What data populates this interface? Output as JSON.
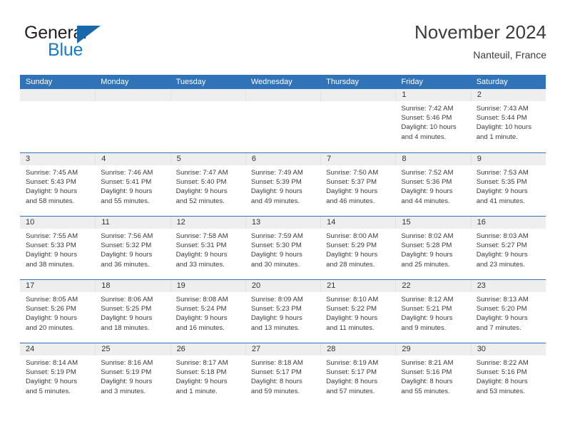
{
  "brand": {
    "name_top": "General",
    "name_bottom": "Blue",
    "accent_color": "#1769ac",
    "text_color": "#231f20"
  },
  "header": {
    "title": "November 2024",
    "subtitle": "Nanteuil, France"
  },
  "theme": {
    "header_bar_color": "#3173b9",
    "daynum_band_color": "#eeeeee",
    "week_separator_color": "#3173b9"
  },
  "weekdays": [
    "Sunday",
    "Monday",
    "Tuesday",
    "Wednesday",
    "Thursday",
    "Friday",
    "Saturday"
  ],
  "weeks": [
    [
      {
        "day": "",
        "empty": true
      },
      {
        "day": "",
        "empty": true
      },
      {
        "day": "",
        "empty": true
      },
      {
        "day": "",
        "empty": true
      },
      {
        "day": "",
        "empty": true
      },
      {
        "day": "1",
        "sunrise": "Sunrise: 7:42 AM",
        "sunset": "Sunset: 5:46 PM",
        "daylight1": "Daylight: 10 hours",
        "daylight2": "and 4 minutes."
      },
      {
        "day": "2",
        "sunrise": "Sunrise: 7:43 AM",
        "sunset": "Sunset: 5:44 PM",
        "daylight1": "Daylight: 10 hours",
        "daylight2": "and 1 minute."
      }
    ],
    [
      {
        "day": "3",
        "sunrise": "Sunrise: 7:45 AM",
        "sunset": "Sunset: 5:43 PM",
        "daylight1": "Daylight: 9 hours",
        "daylight2": "and 58 minutes."
      },
      {
        "day": "4",
        "sunrise": "Sunrise: 7:46 AM",
        "sunset": "Sunset: 5:41 PM",
        "daylight1": "Daylight: 9 hours",
        "daylight2": "and 55 minutes."
      },
      {
        "day": "5",
        "sunrise": "Sunrise: 7:47 AM",
        "sunset": "Sunset: 5:40 PM",
        "daylight1": "Daylight: 9 hours",
        "daylight2": "and 52 minutes."
      },
      {
        "day": "6",
        "sunrise": "Sunrise: 7:49 AM",
        "sunset": "Sunset: 5:39 PM",
        "daylight1": "Daylight: 9 hours",
        "daylight2": "and 49 minutes."
      },
      {
        "day": "7",
        "sunrise": "Sunrise: 7:50 AM",
        "sunset": "Sunset: 5:37 PM",
        "daylight1": "Daylight: 9 hours",
        "daylight2": "and 46 minutes."
      },
      {
        "day": "8",
        "sunrise": "Sunrise: 7:52 AM",
        "sunset": "Sunset: 5:36 PM",
        "daylight1": "Daylight: 9 hours",
        "daylight2": "and 44 minutes."
      },
      {
        "day": "9",
        "sunrise": "Sunrise: 7:53 AM",
        "sunset": "Sunset: 5:35 PM",
        "daylight1": "Daylight: 9 hours",
        "daylight2": "and 41 minutes."
      }
    ],
    [
      {
        "day": "10",
        "sunrise": "Sunrise: 7:55 AM",
        "sunset": "Sunset: 5:33 PM",
        "daylight1": "Daylight: 9 hours",
        "daylight2": "and 38 minutes."
      },
      {
        "day": "11",
        "sunrise": "Sunrise: 7:56 AM",
        "sunset": "Sunset: 5:32 PM",
        "daylight1": "Daylight: 9 hours",
        "daylight2": "and 36 minutes."
      },
      {
        "day": "12",
        "sunrise": "Sunrise: 7:58 AM",
        "sunset": "Sunset: 5:31 PM",
        "daylight1": "Daylight: 9 hours",
        "daylight2": "and 33 minutes."
      },
      {
        "day": "13",
        "sunrise": "Sunrise: 7:59 AM",
        "sunset": "Sunset: 5:30 PM",
        "daylight1": "Daylight: 9 hours",
        "daylight2": "and 30 minutes."
      },
      {
        "day": "14",
        "sunrise": "Sunrise: 8:00 AM",
        "sunset": "Sunset: 5:29 PM",
        "daylight1": "Daylight: 9 hours",
        "daylight2": "and 28 minutes."
      },
      {
        "day": "15",
        "sunrise": "Sunrise: 8:02 AM",
        "sunset": "Sunset: 5:28 PM",
        "daylight1": "Daylight: 9 hours",
        "daylight2": "and 25 minutes."
      },
      {
        "day": "16",
        "sunrise": "Sunrise: 8:03 AM",
        "sunset": "Sunset: 5:27 PM",
        "daylight1": "Daylight: 9 hours",
        "daylight2": "and 23 minutes."
      }
    ],
    [
      {
        "day": "17",
        "sunrise": "Sunrise: 8:05 AM",
        "sunset": "Sunset: 5:26 PM",
        "daylight1": "Daylight: 9 hours",
        "daylight2": "and 20 minutes."
      },
      {
        "day": "18",
        "sunrise": "Sunrise: 8:06 AM",
        "sunset": "Sunset: 5:25 PM",
        "daylight1": "Daylight: 9 hours",
        "daylight2": "and 18 minutes."
      },
      {
        "day": "19",
        "sunrise": "Sunrise: 8:08 AM",
        "sunset": "Sunset: 5:24 PM",
        "daylight1": "Daylight: 9 hours",
        "daylight2": "and 16 minutes."
      },
      {
        "day": "20",
        "sunrise": "Sunrise: 8:09 AM",
        "sunset": "Sunset: 5:23 PM",
        "daylight1": "Daylight: 9 hours",
        "daylight2": "and 13 minutes."
      },
      {
        "day": "21",
        "sunrise": "Sunrise: 8:10 AM",
        "sunset": "Sunset: 5:22 PM",
        "daylight1": "Daylight: 9 hours",
        "daylight2": "and 11 minutes."
      },
      {
        "day": "22",
        "sunrise": "Sunrise: 8:12 AM",
        "sunset": "Sunset: 5:21 PM",
        "daylight1": "Daylight: 9 hours",
        "daylight2": "and 9 minutes."
      },
      {
        "day": "23",
        "sunrise": "Sunrise: 8:13 AM",
        "sunset": "Sunset: 5:20 PM",
        "daylight1": "Daylight: 9 hours",
        "daylight2": "and 7 minutes."
      }
    ],
    [
      {
        "day": "24",
        "sunrise": "Sunrise: 8:14 AM",
        "sunset": "Sunset: 5:19 PM",
        "daylight1": "Daylight: 9 hours",
        "daylight2": "and 5 minutes."
      },
      {
        "day": "25",
        "sunrise": "Sunrise: 8:16 AM",
        "sunset": "Sunset: 5:19 PM",
        "daylight1": "Daylight: 9 hours",
        "daylight2": "and 3 minutes."
      },
      {
        "day": "26",
        "sunrise": "Sunrise: 8:17 AM",
        "sunset": "Sunset: 5:18 PM",
        "daylight1": "Daylight: 9 hours",
        "daylight2": "and 1 minute."
      },
      {
        "day": "27",
        "sunrise": "Sunrise: 8:18 AM",
        "sunset": "Sunset: 5:17 PM",
        "daylight1": "Daylight: 8 hours",
        "daylight2": "and 59 minutes."
      },
      {
        "day": "28",
        "sunrise": "Sunrise: 8:19 AM",
        "sunset": "Sunset: 5:17 PM",
        "daylight1": "Daylight: 8 hours",
        "daylight2": "and 57 minutes."
      },
      {
        "day": "29",
        "sunrise": "Sunrise: 8:21 AM",
        "sunset": "Sunset: 5:16 PM",
        "daylight1": "Daylight: 8 hours",
        "daylight2": "and 55 minutes."
      },
      {
        "day": "30",
        "sunrise": "Sunrise: 8:22 AM",
        "sunset": "Sunset: 5:16 PM",
        "daylight1": "Daylight: 8 hours",
        "daylight2": "and 53 minutes."
      }
    ]
  ]
}
